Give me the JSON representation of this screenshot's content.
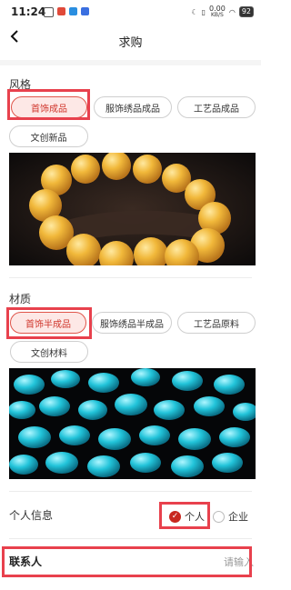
{
  "status_bar": {
    "time": "11:24",
    "net_speed_value": "0.00",
    "net_speed_unit": "KB/S",
    "battery": "92",
    "icons": [
      "moon-icon",
      "vibrate-icon",
      "signal-icon",
      "wifi-icon",
      "battery-icon"
    ]
  },
  "nav": {
    "title": "求购",
    "back_icon": "chevron-left-icon"
  },
  "style_section": {
    "label": "风格",
    "chips": [
      {
        "label": "首饰成品",
        "selected": true
      },
      {
        "label": "服饰绣品成品",
        "selected": false
      },
      {
        "label": "工艺品成品",
        "selected": false
      },
      {
        "label": "文创新品",
        "selected": false
      }
    ]
  },
  "material_section": {
    "label": "材质",
    "chips": [
      {
        "label": "首饰半成品",
        "selected": true
      },
      {
        "label": "服饰绣品半成品",
        "selected": false
      },
      {
        "label": "工艺品原料",
        "selected": false
      },
      {
        "label": "文创材料",
        "selected": false
      }
    ]
  },
  "personal_info": {
    "label": "个人信息",
    "options": [
      {
        "label": "个人",
        "selected": true
      },
      {
        "label": "企业",
        "selected": false
      }
    ]
  },
  "contact": {
    "label": "联系人",
    "placeholder": "请输入"
  },
  "colors": {
    "accent": "#d0352b",
    "highlight": "#e8414d",
    "chip_selected_bg": "#fde8e6"
  }
}
